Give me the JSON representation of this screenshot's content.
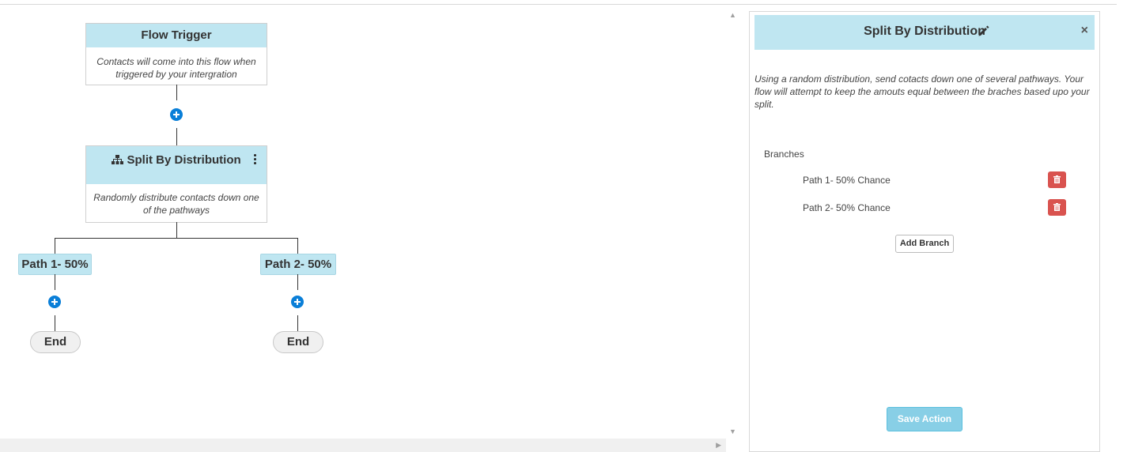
{
  "flow": {
    "trigger": {
      "title": "Flow Trigger",
      "description": "Contacts will come into this flow when triggered by your intergration"
    },
    "split": {
      "title": "Split By Distribution",
      "description": "Randomly distribute contacts down one of the pathways",
      "icon": "sitemap-icon"
    },
    "paths": [
      {
        "label": "Path 1- 50%",
        "end": "End"
      },
      {
        "label": "Path 2- 50%",
        "end": "End"
      }
    ]
  },
  "panel": {
    "title": "Split By Distribution",
    "close": "×",
    "description": "Using a random distribution, send cotacts down one of several pathways. Your flow will attempt to keep the amouts equal between the braches based upo your split.",
    "branches_label": "Branches",
    "branches": [
      {
        "label": "Path 1- 50% Chance"
      },
      {
        "label": "Path 2- 50% Chance"
      }
    ],
    "add_branch": "Add Branch",
    "save": "Save Action"
  },
  "colors": {
    "node_header": "#bfe6f1",
    "plus_button": "#0a7fd8",
    "danger": "#d9534f",
    "save_button": "#88cfe6"
  }
}
